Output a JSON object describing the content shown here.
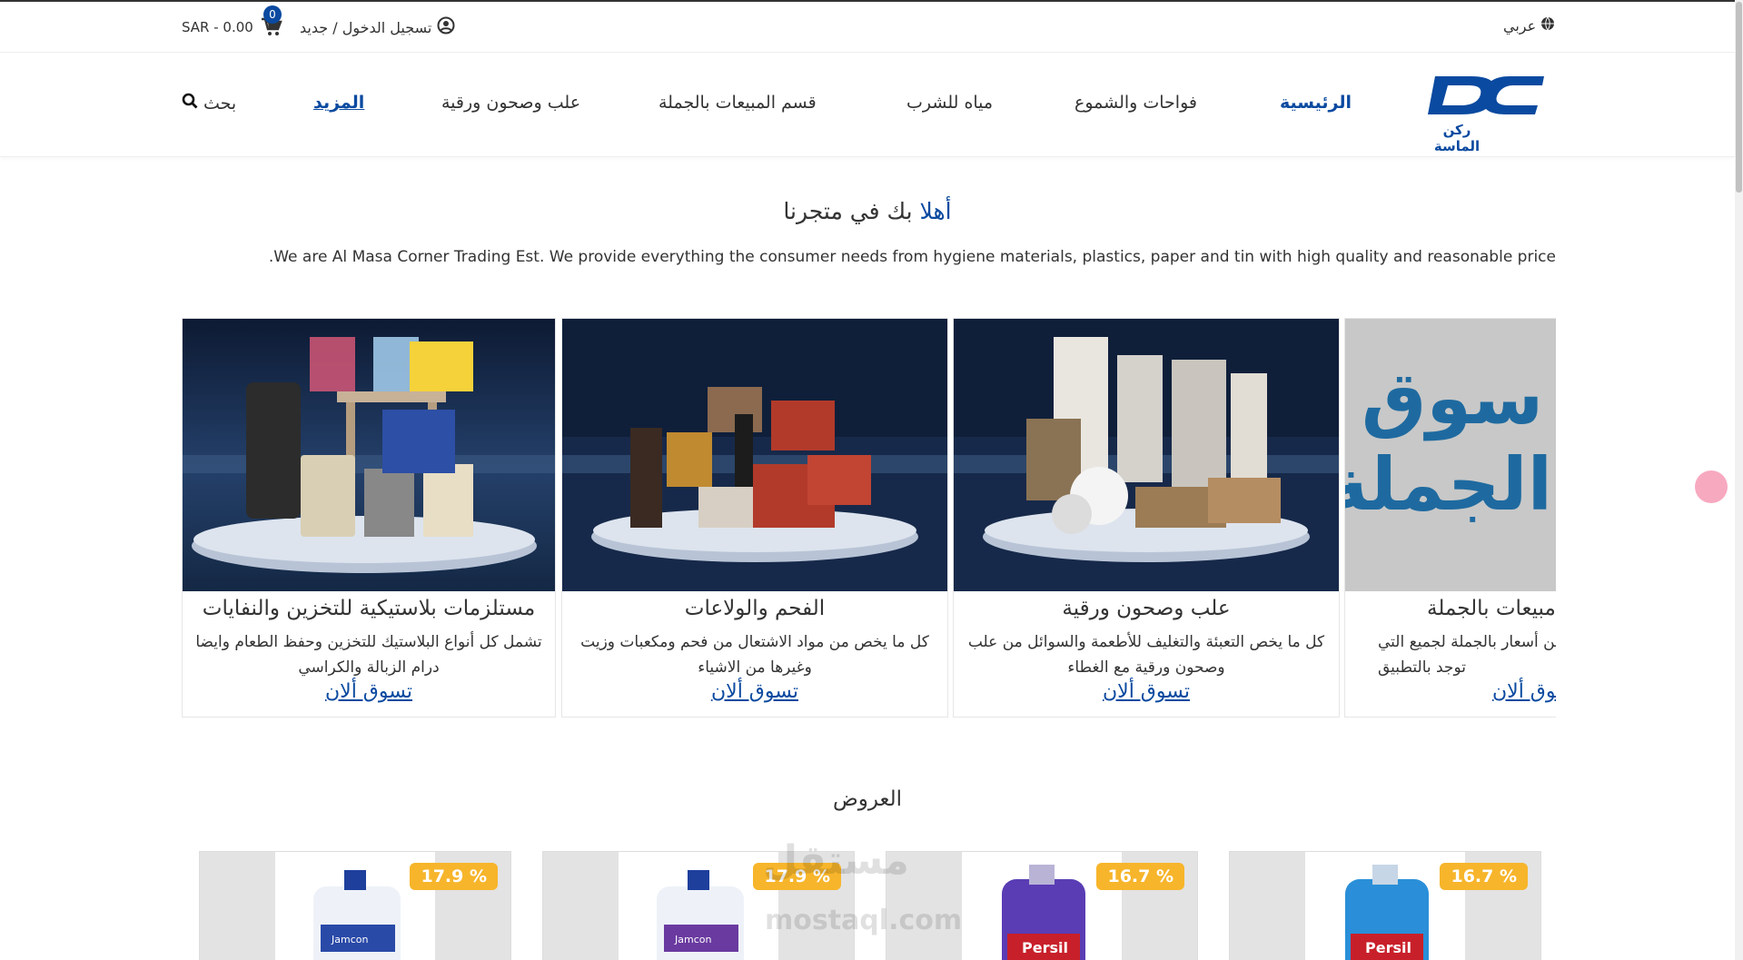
{
  "topbar": {
    "cart_text": "SAR - 0.00",
    "cart_count": "0",
    "login_text": "تسجيل الدخول / جديد",
    "language": "عربي"
  },
  "nav": {
    "home": "الرئيسية",
    "item1": "فواحات والشموع",
    "item2": "مياه للشرب",
    "item3": "قسم المبيعات بالجملة",
    "item4": "علب وصحون ورقية",
    "more": "المزيد",
    "search": "بحث",
    "logo_text": "ركن الماسة"
  },
  "welcome": {
    "title_highlight": "أهلا",
    "title_rest": " بك في متجرنا",
    "text": "We are Al Masa Corner Trading Est. We provide everything the consumer needs from hygiene materials, plastics, paper and tin with high quality and reasonable price."
  },
  "categories": [
    {
      "title": "مستلزمات بلاستيكية للتخزين والنفايات",
      "desc": "تشمل كل أنواع البلاستيك للتخزين وحفظ الطعام وايضا درام الزبالة والكراسي",
      "shop": "تسوق ألان"
    },
    {
      "title": "الفحم والولاعات",
      "desc": "كل ما يخص من مواد الاشتعال من فحم ومكعبات وزيت وغيرها من الاشياء",
      "shop": "تسوق ألان"
    },
    {
      "title": "علب وصحون ورقية",
      "desc": "كل ما يخص التعبئة والتغليف للأطعمة والسوائل من علب وصحون ورقية مع الغطاء",
      "shop": "تسوق ألان"
    },
    {
      "title": "مبيعات بالجملة",
      "desc": "من أسعار بالجملة لجميع التي توجد بالتطبيق",
      "shop": "تسوق ألان",
      "banner": "سوق الجملة"
    }
  ],
  "offers": {
    "title": "العروض",
    "items": [
      {
        "discount": "17.9 %",
        "brand": "Jamcon"
      },
      {
        "discount": "17.9 %",
        "brand": "Jamcon"
      },
      {
        "discount": "16.7 %",
        "brand": "Persil"
      },
      {
        "discount": "16.7 %",
        "brand": "Persil"
      }
    ]
  },
  "watermark": {
    "line1": "مستقل",
    "line2": "mostaql.com"
  },
  "colors": {
    "brand": "#0a4aa0",
    "discount": "#f7b52b"
  }
}
